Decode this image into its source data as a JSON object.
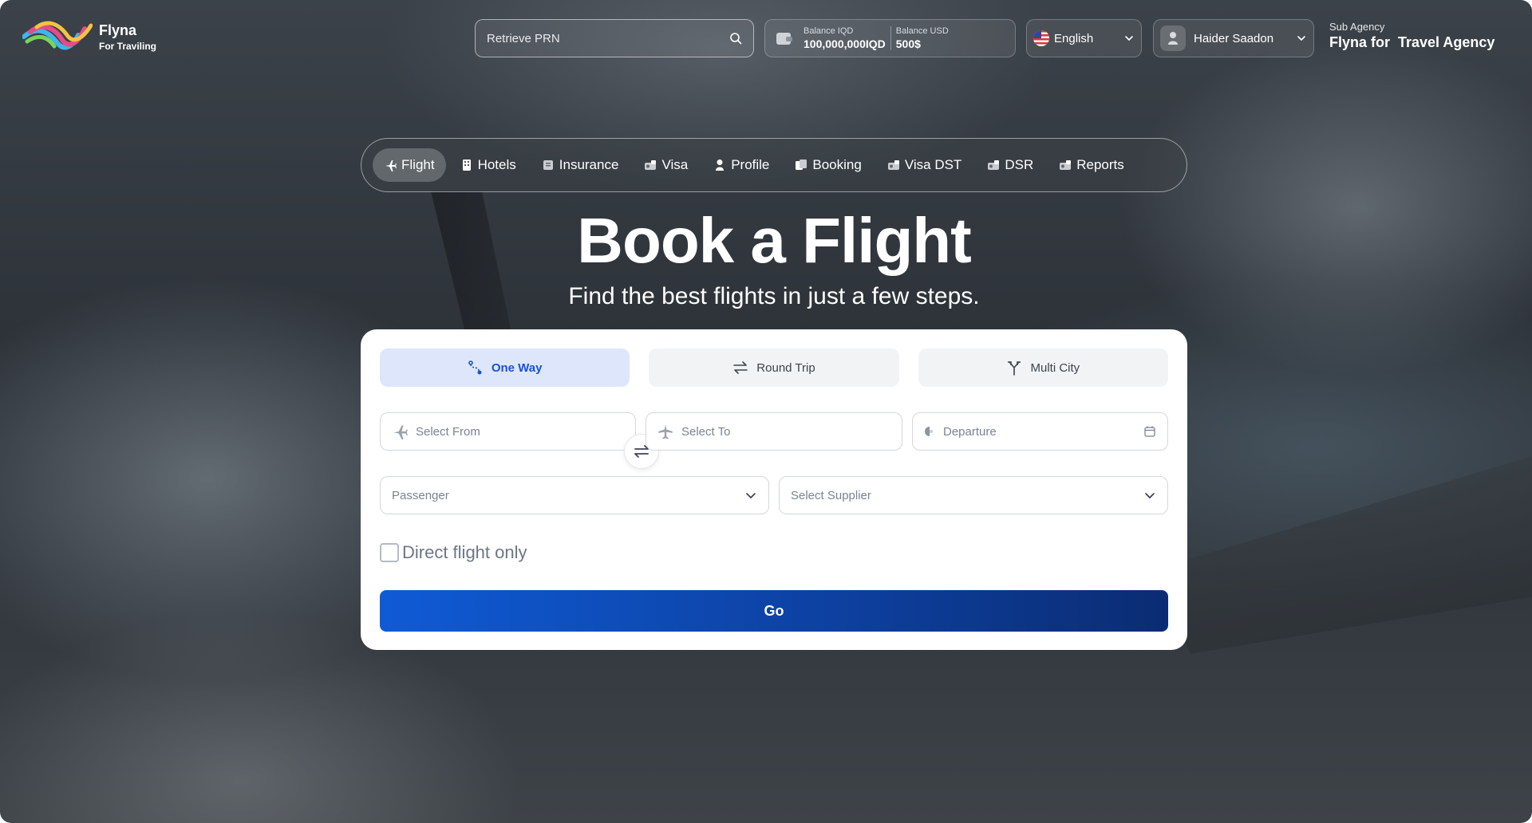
{
  "brand": {
    "name": "Flyna",
    "tagline": "For Traviling"
  },
  "header": {
    "search_placeholder": "Retrieve PRN",
    "balance_iqd_label": "Balance IQD",
    "balance_iqd_value": "100,000,000IQD",
    "balance_usd_label": "Balance USD",
    "balance_usd_value": "500$",
    "language": "English",
    "user_name": "Haider Saadon",
    "agency_label": "Sub Agency",
    "agency_name": "Flyna for  Travel Agency"
  },
  "nav": {
    "items": [
      {
        "label": "Flight",
        "icon": "plane-icon",
        "active": true
      },
      {
        "label": "Hotels",
        "icon": "hotel-icon"
      },
      {
        "label": "Insurance",
        "icon": "insurance-icon"
      },
      {
        "label": "Visa",
        "icon": "visa-icon"
      },
      {
        "label": "Profile",
        "icon": "profile-icon"
      },
      {
        "label": "Booking",
        "icon": "booking-icon"
      },
      {
        "label": "Visa DST",
        "icon": "visa-dst-icon"
      },
      {
        "label": "DSR",
        "icon": "dsr-icon"
      },
      {
        "label": "Reports",
        "icon": "reports-icon"
      }
    ]
  },
  "hero": {
    "title": "Book a Flight",
    "subtitle": "Find the best flights in just a few steps."
  },
  "form": {
    "trip_types": [
      {
        "label": "One Way",
        "active": true
      },
      {
        "label": "Round Trip"
      },
      {
        "label": "Multi City"
      }
    ],
    "from_placeholder": "Select From",
    "to_placeholder": "Select To",
    "departure_placeholder": "Departure",
    "passenger_placeholder": "Passenger",
    "supplier_placeholder": "Select Supplier",
    "direct_flight_label": "Direct flight only",
    "direct_flight_checked": false,
    "submit_label": "Go"
  },
  "colors": {
    "primary": "#0f5bd6",
    "primary_dark": "#0b2c73",
    "active_tab_bg": "#dde6fb"
  }
}
